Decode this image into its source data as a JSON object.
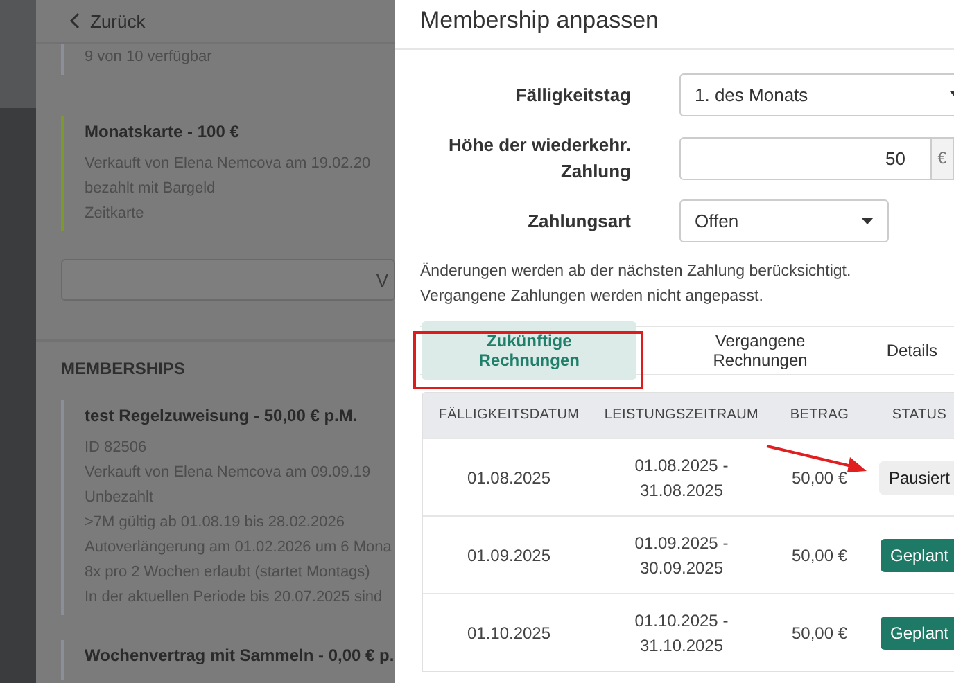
{
  "back_link": {
    "label": "Zurück"
  },
  "background_page": {
    "entries": [
      {
        "lines": [
          "9 von 10 verfügbar"
        ],
        "color": "#8a8f99"
      },
      {
        "title": "Monatskarte - 100 €",
        "lines": [
          "Verkauft von Elena Nemcova am 19.02.20",
          "bezahlt mit Bargeld",
          "Zeitkarte"
        ],
        "color": "#7c9a2c"
      }
    ],
    "button_label": "V",
    "section_title": "MEMBERSHIPS",
    "memberships": [
      {
        "title": "test Regelzuweisung - 50,00 € p.M.",
        "lines": [
          "ID 82506",
          "Verkauft von Elena Nemcova am 09.09.19",
          "Unbezahlt",
          ">7M gültig ab 01.08.19 bis 28.02.2026",
          "Autoverlängerung am 01.02.2026 um 6 Mona",
          "8x pro 2 Wochen erlaubt (startet Montags)",
          "In der aktuellen Periode bis 20.07.2025 sind"
        ],
        "color": "#8a8f99"
      },
      {
        "title": "Wochenvertrag mit Sammeln - 0,00 € p.",
        "color": "#8a8f99"
      }
    ]
  },
  "dialog": {
    "title": "Membership anpassen",
    "fields": [
      {
        "kind": "select",
        "label": "Fälligkeitstag",
        "value": "1. des Monats"
      },
      {
        "kind": "amount",
        "label": "Höhe der wiederkehr. Zahlung",
        "value": "50",
        "unit": "€"
      },
      {
        "kind": "select",
        "label": "Zahlungsart",
        "value": "Offen"
      }
    ],
    "note": [
      "Änderungen werden ab der nächsten Zahlung berücksichtigt.",
      "Vergangene Zahlungen werden nicht angepasst."
    ],
    "tabs": [
      {
        "label": "Zukünftige Rechnungen",
        "selected": true
      },
      {
        "label": "Vergangene Rechnungen",
        "selected": false
      },
      {
        "label": "Details",
        "selected": false
      }
    ],
    "table": {
      "columns": [
        "FÄLLIGKEITSDATUM",
        "LEISTUNGSZEITRAUM",
        "BETRAG",
        "STATUS"
      ],
      "rows": [
        {
          "due": "01.08.2025",
          "period": "01.08.2025 - 31.08.2025",
          "amount": "50,00 €",
          "status": "Pausiert",
          "paused": true
        },
        {
          "due": "01.09.2025",
          "period": "01.09.2025 - 30.09.2025",
          "amount": "50,00 €",
          "status": "Geplant",
          "paused": false
        },
        {
          "due": "01.10.2025",
          "period": "01.10.2025 - 31.10.2025",
          "amount": "50,00 €",
          "status": "Geplant",
          "paused": false
        }
      ]
    }
  }
}
